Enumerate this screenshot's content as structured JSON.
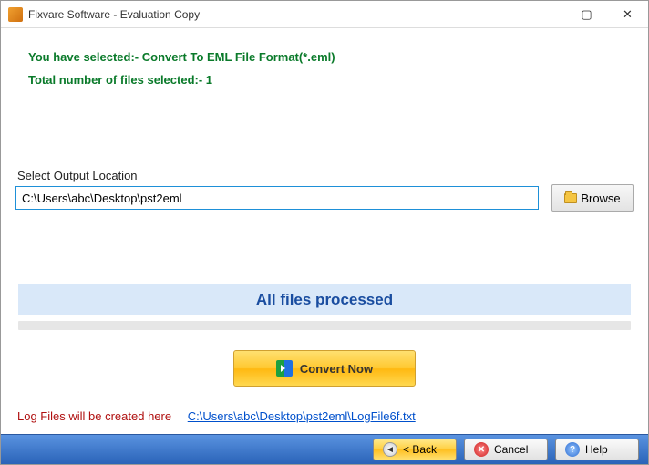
{
  "window": {
    "title": "Fixvare Software - Evaluation Copy"
  },
  "info": {
    "selected_format": "You have selected:- Convert To EML File Format(*.eml)",
    "file_count": "Total number of files selected:- 1"
  },
  "output": {
    "label": "Select Output Location",
    "path": "C:\\Users\\abc\\Desktop\\pst2eml",
    "browse": "Browse"
  },
  "status": {
    "message": "All files processed"
  },
  "actions": {
    "convert": "Convert Now"
  },
  "log": {
    "label": "Log Files will be created here",
    "path": "C:\\Users\\abc\\Desktop\\pst2eml\\LogFile6f.txt"
  },
  "footer": {
    "back": "< Back",
    "cancel": "Cancel",
    "help": "Help"
  }
}
